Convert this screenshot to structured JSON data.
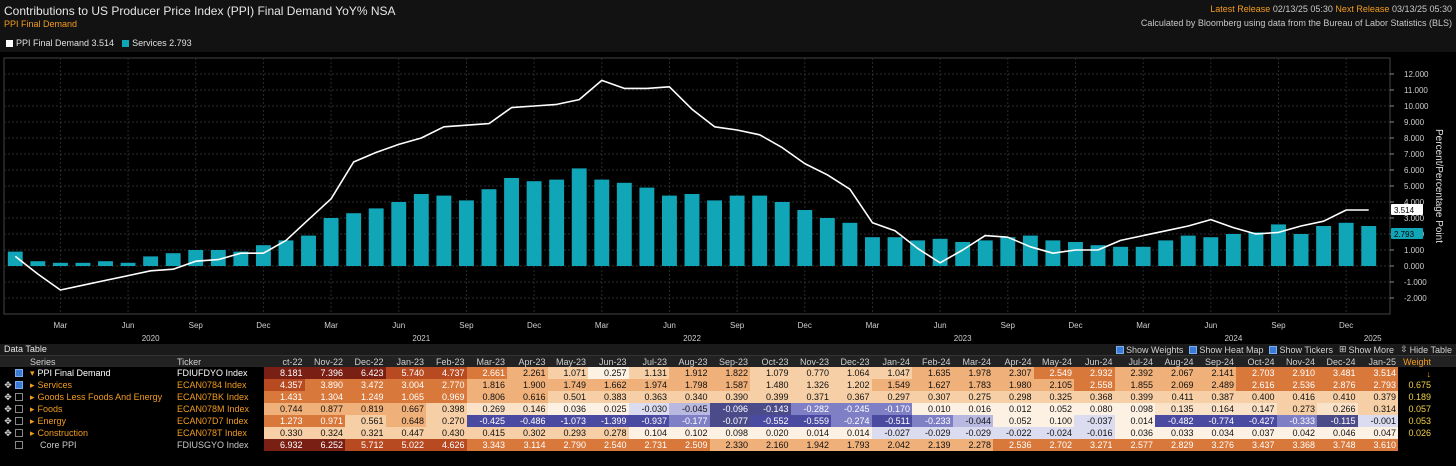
{
  "header": {
    "title": "Contributions to US Producer Price Index (PPI) Final Demand YoY% NSA",
    "subtitle": "PPI Final Demand",
    "latest_release_label": "Latest Release",
    "latest_release_value": "02/13/25 05:30",
    "next_release_label": "Next Release",
    "next_release_value": "03/13/25 05:30",
    "source": "Calculated by Bloomberg using data from the Bureau of Labor Statistics (BLS)"
  },
  "legend": [
    {
      "label": "PPI Final Demand 3.514",
      "color": "#ffffff"
    },
    {
      "label": "Services 2.793",
      "color": "#11a5b8"
    }
  ],
  "chart_data": {
    "type": "bar",
    "ylabel": "Percent/Percentage Point",
    "ylim": [
      -3,
      13
    ],
    "yticks": [
      "12.000",
      "11.000",
      "10.000",
      "9.000",
      "8.000",
      "7.000",
      "6.000",
      "5.000",
      "4.000",
      "3.000",
      "2.000",
      "1.000",
      "0.000",
      "-1.000",
      "-2.000"
    ],
    "x_month_labels": [
      "Mar",
      "Jun",
      "Sep",
      "Dec",
      "Mar",
      "Jun",
      "Sep",
      "Dec",
      "Mar",
      "Jun",
      "Sep",
      "Dec",
      "Mar",
      "Jun",
      "Sep",
      "Dec",
      "Mar",
      "Jun",
      "Sep",
      "Dec"
    ],
    "x_year_labels": [
      "2020",
      "2021",
      "2022",
      "2023",
      "2024",
      "2025"
    ],
    "categories": [
      "Jan-20",
      "Feb-20",
      "Mar-20",
      "Apr-20",
      "May-20",
      "Jun-20",
      "Jul-20",
      "Aug-20",
      "Sep-20",
      "Oct-20",
      "Nov-20",
      "Dec-20",
      "Jan-21",
      "Feb-21",
      "Mar-21",
      "Apr-21",
      "May-21",
      "Jun-21",
      "Jul-21",
      "Aug-21",
      "Sep-21",
      "Oct-21",
      "Nov-21",
      "Dec-21",
      "Jan-22",
      "Feb-22",
      "Mar-22",
      "Apr-22",
      "May-22",
      "Jun-22",
      "Jul-22",
      "Aug-22",
      "Sep-22",
      "Oct-22",
      "Nov-22",
      "Dec-22",
      "Jan-23",
      "Feb-23",
      "Mar-23",
      "Apr-23",
      "May-23",
      "Jun-23",
      "Jul-23",
      "Aug-23",
      "Sep-23",
      "Oct-23",
      "Nov-23",
      "Dec-23",
      "Jan-24",
      "Feb-24",
      "Mar-24",
      "Apr-24",
      "May-24",
      "Jun-24",
      "Jul-24",
      "Aug-24",
      "Sep-24",
      "Oct-24",
      "Nov-24",
      "Dec-24",
      "Jan-25"
    ],
    "series": [
      {
        "name": "Services",
        "type": "bar",
        "color": "#11a5b8",
        "values": [
          0.9,
          0.3,
          0.2,
          0.2,
          0.3,
          0.2,
          0.6,
          0.8,
          1.0,
          1.0,
          0.9,
          1.3,
          1.6,
          1.9,
          3.0,
          3.3,
          3.6,
          4.0,
          4.5,
          4.4,
          4.1,
          4.8,
          5.5,
          5.3,
          5.4,
          6.1,
          5.4,
          5.2,
          4.9,
          4.4,
          4.5,
          4.1,
          4.4,
          4.4,
          4.0,
          3.5,
          3.0,
          2.7,
          1.8,
          1.8,
          1.6,
          1.7,
          1.5,
          1.6,
          1.8,
          1.9,
          1.6,
          1.5,
          1.3,
          1.2,
          1.2,
          1.6,
          1.9,
          1.8,
          2.0,
          2.1,
          2.6,
          2.0,
          2.5,
          2.7,
          2.5
        ]
      },
      {
        "name": "PPI Final Demand",
        "type": "line",
        "color": "#ffffff",
        "values": [
          0.6,
          -0.5,
          -1.5,
          -1.2,
          -0.9,
          -0.6,
          -0.3,
          -0.2,
          0.3,
          0.4,
          0.8,
          0.8,
          1.6,
          2.9,
          4.2,
          6.5,
          7.1,
          7.6,
          8.0,
          8.7,
          8.8,
          8.9,
          9.9,
          10.0,
          10.1,
          10.4,
          11.6,
          11.1,
          11.1,
          11.2,
          9.8,
          8.7,
          8.5,
          8.2,
          7.4,
          6.4,
          5.7,
          4.8,
          2.7,
          2.2,
          1.1,
          0.2,
          1.0,
          1.9,
          1.8,
          1.2,
          0.8,
          1.0,
          1.0,
          1.6,
          1.9,
          2.2,
          2.5,
          2.9,
          2.4,
          2.0,
          2.1,
          2.5,
          2.8,
          3.5,
          3.5
        ]
      }
    ],
    "last_value_labels": {
      "ppi": "3.514",
      "services": "2.793"
    }
  },
  "data_table": {
    "title": "Data Table",
    "options": [
      "Show Weights",
      "Show Heat Map",
      "Show Tickers",
      "Show More",
      "Hide Table"
    ],
    "col_series": "Series",
    "col_ticker": "Ticker",
    "col_weight": "Weight",
    "months": [
      "ct-22",
      "Nov-22",
      "Dec-22",
      "Jan-23",
      "Feb-23",
      "Mar-23",
      "Apr-23",
      "May-23",
      "Jun-23",
      "Jul-23",
      "Aug-23",
      "Sep-23",
      "Oct-23",
      "Nov-23",
      "Dec-23",
      "Jan-24",
      "Feb-24",
      "Mar-24",
      "Apr-24",
      "May-24",
      "Jun-24",
      "Jul-24",
      "Aug-24",
      "Sep-24",
      "Oct-24",
      "Nov-24",
      "Dec-24",
      "Jan-25"
    ],
    "rows": [
      {
        "series": "PPI Final Demand",
        "ticker": "FDIUFDYO Index",
        "weight": "",
        "style": "main",
        "values": [
          "8.181",
          "7.396",
          "6.423",
          "5.740",
          "4.737",
          "2.661",
          "2.261",
          "1.071",
          "0.257",
          "1.131",
          "1.912",
          "1.822",
          "1.079",
          "0.770",
          "1.064",
          "1.047",
          "1.635",
          "1.978",
          "2.307",
          "2.549",
          "2.932",
          "2.392",
          "2.067",
          "2.141",
          "2.703",
          "2.910",
          "3.481",
          "3.514"
        ]
      },
      {
        "series": "Services",
        "ticker": "ECAN0784 Index",
        "weight": "0.675",
        "style": "orange",
        "values": [
          "4.357",
          "3.890",
          "3.472",
          "3.004",
          "2.770",
          "1.816",
          "1.900",
          "1.749",
          "1.662",
          "1.974",
          "1.798",
          "1.587",
          "1.480",
          "1.326",
          "1.202",
          "1.549",
          "1.627",
          "1.783",
          "1.980",
          "2.105",
          "2.558",
          "1.855",
          "2.069",
          "2.489",
          "2.616",
          "2.536",
          "2.876",
          "2.793"
        ]
      },
      {
        "series": "Goods Less Foods And Energy",
        "ticker": "ECAN07BK Index",
        "weight": "0.189",
        "style": "orange",
        "values": [
          "1.431",
          "1.304",
          "1.249",
          "1.065",
          "0.969",
          "0.806",
          "0.616",
          "0.501",
          "0.383",
          "0.363",
          "0.340",
          "0.390",
          "0.399",
          "0.371",
          "0.367",
          "0.297",
          "0.307",
          "0.275",
          "0.298",
          "0.325",
          "0.368",
          "0.399",
          "0.411",
          "0.387",
          "0.400",
          "0.416",
          "0.410",
          "0.379"
        ]
      },
      {
        "series": "Foods",
        "ticker": "ECAN078M Index",
        "weight": "0.057",
        "style": "orange",
        "values": [
          "0.744",
          "0.877",
          "0.819",
          "0.667",
          "0.398",
          "0.269",
          "0.146",
          "0.036",
          "0.025",
          "-0.030",
          "-0.045",
          "-0.096",
          "-0.143",
          "-0.282",
          "-0.245",
          "-0.170",
          "0.010",
          "0.016",
          "0.012",
          "0.052",
          "0.080",
          "0.098",
          "0.135",
          "0.164",
          "0.147",
          "0.273",
          "0.266",
          "0.314"
        ]
      },
      {
        "series": "Energy",
        "ticker": "ECAN07D7 Index",
        "weight": "0.053",
        "style": "orange",
        "values": [
          "1.273",
          "0.971",
          "0.561",
          "0.648",
          "0.270",
          "-0.425",
          "-0.486",
          "-1.073",
          "-1.399",
          "-0.937",
          "-0.177",
          "-0.077",
          "-0.552",
          "-0.559",
          "-0.274",
          "-0.511",
          "-0.233",
          "-0.044",
          "0.052",
          "0.100",
          "-0.037",
          "0.014",
          "-0.482",
          "-0.774",
          "-0.427",
          "-0.333",
          "-0.115",
          "-0.001"
        ]
      },
      {
        "series": "Construction",
        "ticker": "ECAN078T Index",
        "weight": "0.026",
        "style": "orange",
        "values": [
          "0.330",
          "0.324",
          "0.321",
          "0.447",
          "0.430",
          "0.415",
          "0.302",
          "0.293",
          "0.278",
          "0.104",
          "0.102",
          "0.098",
          "0.020",
          "0.014",
          "0.014",
          "-0.027",
          "-0.029",
          "-0.029",
          "-0.022",
          "-0.024",
          "-0.016",
          "0.036",
          "0.033",
          "0.034",
          "0.037",
          "0.042",
          "0.046",
          "0.047"
        ]
      },
      {
        "series": "Core PPI",
        "ticker": "FDIUSGYO Index",
        "weight": "",
        "style": "grey",
        "values": [
          "6.932",
          "6.252",
          "5.712",
          "5.022",
          "4.626",
          "3.343",
          "3.114",
          "2.790",
          "2.540",
          "2.731",
          "2.509",
          "2.330",
          "2.160",
          "1.942",
          "1.793",
          "2.042",
          "2.139",
          "2.278",
          "2.536",
          "2.702",
          "3.271",
          "2.577",
          "2.829",
          "3.276",
          "3.437",
          "3.368",
          "3.748",
          "3.610"
        ]
      }
    ]
  }
}
